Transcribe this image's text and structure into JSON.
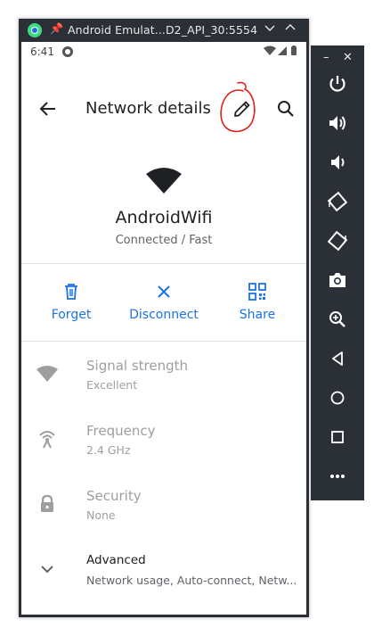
{
  "window": {
    "title": "Android Emulat...D2_API_30:5554",
    "controls": [
      "chevron-down-icon",
      "chevron-up-icon",
      "close-icon"
    ]
  },
  "statusbar": {
    "time": "6:41"
  },
  "appbar": {
    "title": "Network details",
    "icons": [
      "back-arrow-icon",
      "edit-pencil-icon",
      "search-icon"
    ]
  },
  "network": {
    "name": "AndroidWifi",
    "status": "Connected / Fast"
  },
  "actions": [
    {
      "label": "Forget",
      "icon": "trash-icon"
    },
    {
      "label": "Disconnect",
      "icon": "x-icon"
    },
    {
      "label": "Share",
      "icon": "qr-code-icon"
    }
  ],
  "details": [
    {
      "title": "Signal strength",
      "value": "Excellent",
      "icon": "wifi-icon"
    },
    {
      "title": "Frequency",
      "value": "2.4 GHz",
      "icon": "antenna-icon"
    },
    {
      "title": "Security",
      "value": "None",
      "icon": "lock-icon"
    },
    {
      "title": "Advanced",
      "value": "Network usage, Auto-connect, Netw...",
      "icon": "chevron-down-icon"
    }
  ],
  "side_toolbar": {
    "buttons": [
      "power-icon",
      "volume-up-icon",
      "volume-down-icon",
      "rotate-left-icon",
      "rotate-right-icon",
      "camera-icon",
      "zoom-icon",
      "back-triangle-icon",
      "home-circle-icon",
      "overview-square-icon",
      "more-icon"
    ]
  },
  "colors": {
    "accent": "#1a73e8",
    "frame": "#2b3036",
    "annotation": "#e0201a"
  }
}
